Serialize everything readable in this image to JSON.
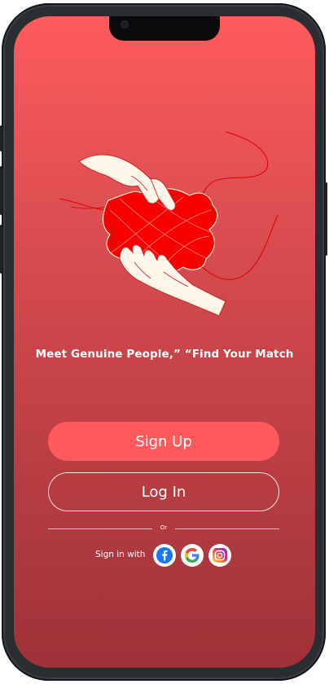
{
  "tagline": "Meet Genuine People,” “Find Your Match",
  "buttons": {
    "signup": "Sign Up",
    "login": "Log In"
  },
  "divider_text": "Or",
  "signin_with": "Sign in with",
  "social": [
    {
      "name": "facebook",
      "icon": "facebook-icon",
      "color": "#1877f2"
    },
    {
      "name": "google",
      "icon": "google-icon",
      "color": "#4285f4"
    },
    {
      "name": "instagram",
      "icon": "instagram-icon",
      "color": "#e1306c"
    }
  ],
  "colors": {
    "background_top": "#fe5b5d",
    "background_bottom": "#9e3239",
    "primary_button": "#fe5a5c",
    "illustration_red": "#f50000"
  }
}
